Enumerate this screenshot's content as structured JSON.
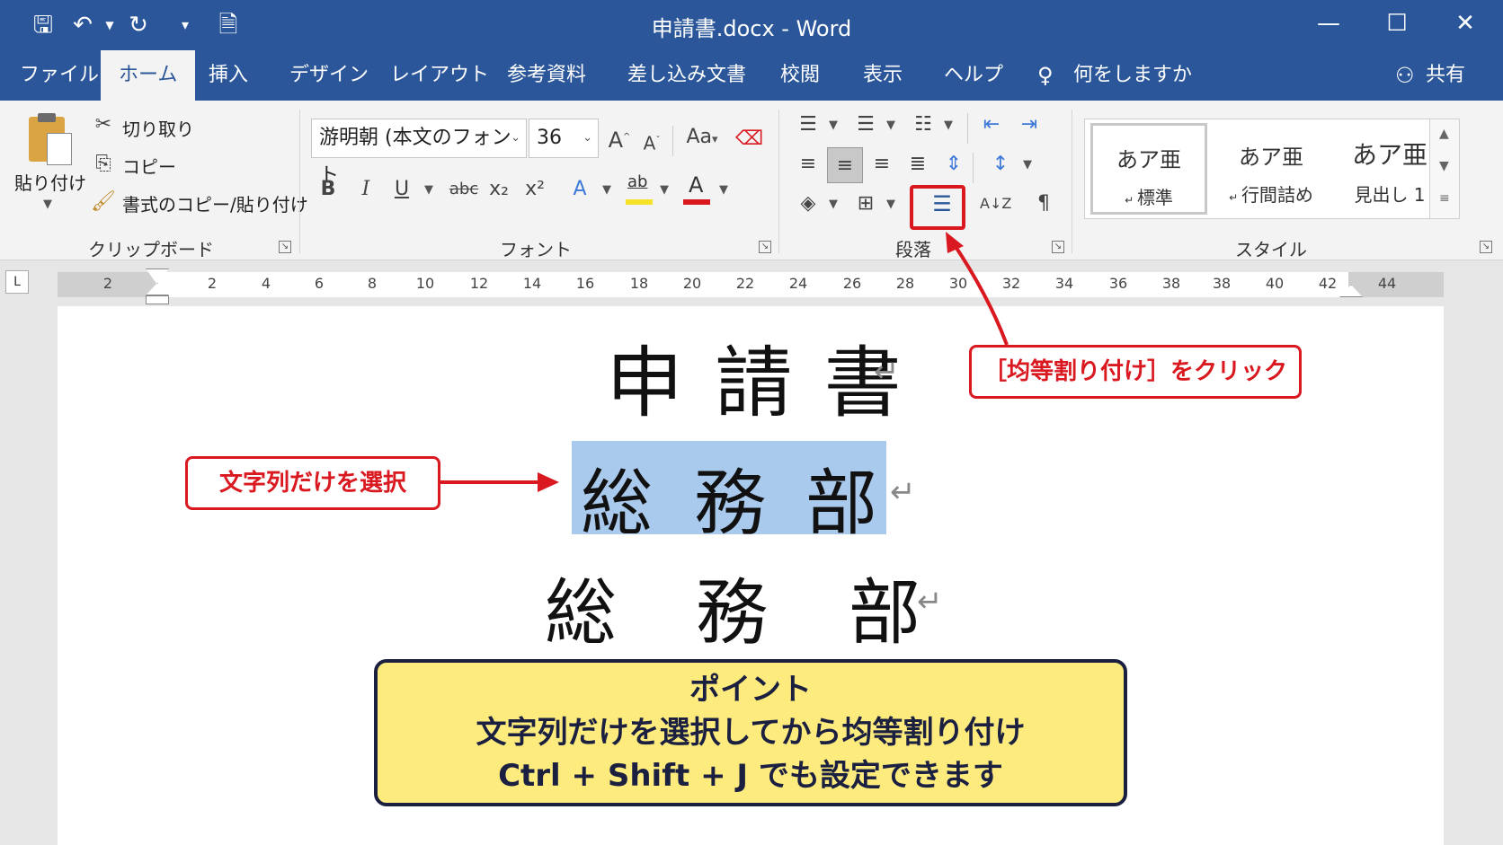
{
  "window": {
    "title": "申請書.docx  -  Word",
    "controls": {
      "minimize": "—",
      "maximize": "☐",
      "close": "✕"
    }
  },
  "quick_access": [
    "save-icon",
    "undo-icon",
    "redo-icon",
    "customize-icon",
    "document-icon"
  ],
  "tabs": {
    "file": "ファイル",
    "home": "ホーム",
    "insert": "挿入",
    "design": "デザイン",
    "layout": "レイアウト",
    "references": "参考資料",
    "mailings": "差し込み文書",
    "review": "校閲",
    "view": "表示",
    "help": "ヘルプ",
    "tell_me": "何をしますか",
    "share": "共有"
  },
  "clipboard": {
    "paste": "貼り付け",
    "cut": "切り取り",
    "copy": "コピー",
    "format_painter": "書式のコピー/貼り付け",
    "label": "クリップボード"
  },
  "font": {
    "name": "游明朝 (本文のフォント",
    "size": "36",
    "grow": "A",
    "shrink": "A",
    "case": "Aa",
    "bold": "B",
    "italic": "I",
    "underline": "U",
    "strike": "abc",
    "sub": "x₂",
    "sup": "x²",
    "effects": "A",
    "highlight": "ab",
    "color": "A",
    "label": "フォント"
  },
  "paragraph": {
    "label": "段落",
    "sort": "A↓Z"
  },
  "styles": {
    "label": "スタイル",
    "items": [
      {
        "sample": "あア亜",
        "name": "標準"
      },
      {
        "sample": "あア亜",
        "name": "行間詰め"
      },
      {
        "sample": "あア亜",
        "name": "見出し 1"
      }
    ]
  },
  "ruler": {
    "tab_selector": "L",
    "left_numbers": [
      "2"
    ],
    "numbers": [
      "2",
      "4",
      "6",
      "8",
      "10",
      "12",
      "14",
      "16",
      "18",
      "20",
      "22",
      "24",
      "26",
      "28",
      "30",
      "32",
      "34",
      "36",
      "38",
      "38",
      "40",
      "42"
    ],
    "right_number": "44"
  },
  "document": {
    "title": "申 請 書",
    "line2": [
      "総",
      "務",
      "部"
    ],
    "line3": [
      "総",
      "務",
      "部"
    ],
    "return_mark": "↵"
  },
  "annotations": {
    "distribute_callout": "［均等割り付け］をクリック",
    "select_callout": "文字列だけを選択",
    "point": {
      "heading": "ポイント",
      "line1": "文字列だけを選択してから均等割り付け",
      "line2": "Ctrl + Shift + J でも設定できます"
    }
  },
  "colors": {
    "title_bar": "#2b579a",
    "callout_red": "#d9181f",
    "point_bg": "#fdeb7e",
    "selection": "#a9c9ed"
  }
}
